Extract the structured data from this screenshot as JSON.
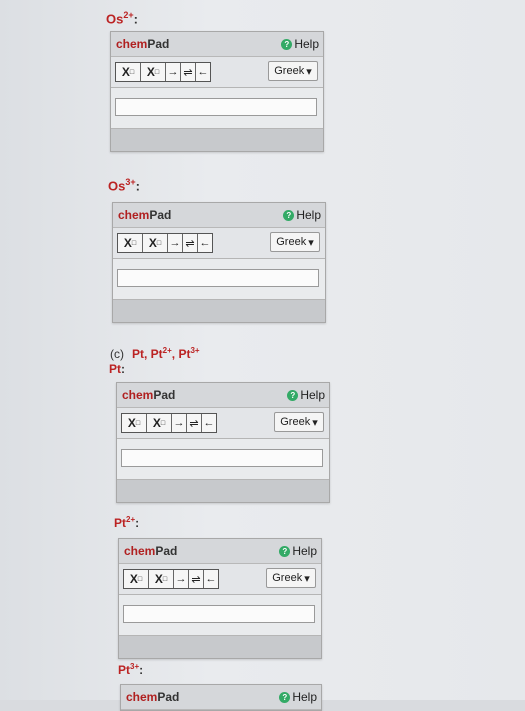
{
  "questions": {
    "os2": {
      "symbol": "Os",
      "charge": "2+"
    },
    "os3": {
      "symbol": "Os",
      "charge": "3+"
    },
    "part_c": {
      "number": "(c)",
      "list_prefix": "Pt, Pt",
      "charge_a": "2+",
      "list_mid": ", Pt",
      "charge_b": "3+"
    },
    "pt": {
      "symbol": "Pt"
    },
    "pt2": {
      "symbol": "Pt",
      "charge": "2+"
    },
    "pt3": {
      "symbol": "Pt",
      "charge": "3+"
    },
    "colon": ":"
  },
  "chempad": {
    "title_prefix": "chem",
    "title_suffix": "Pad",
    "help_label": "Help",
    "help_icon": "question-icon",
    "greek_label": "Greek",
    "dropdown_glyph": "▾",
    "tools": {
      "subscript": "X",
      "superscript": "X",
      "box": "□",
      "right_arrow": "→",
      "equilibrium_arrow": "⇌",
      "left_arrow": "←"
    }
  },
  "colors": {
    "element_red": "#b22222",
    "help_green": "#33aa66"
  }
}
